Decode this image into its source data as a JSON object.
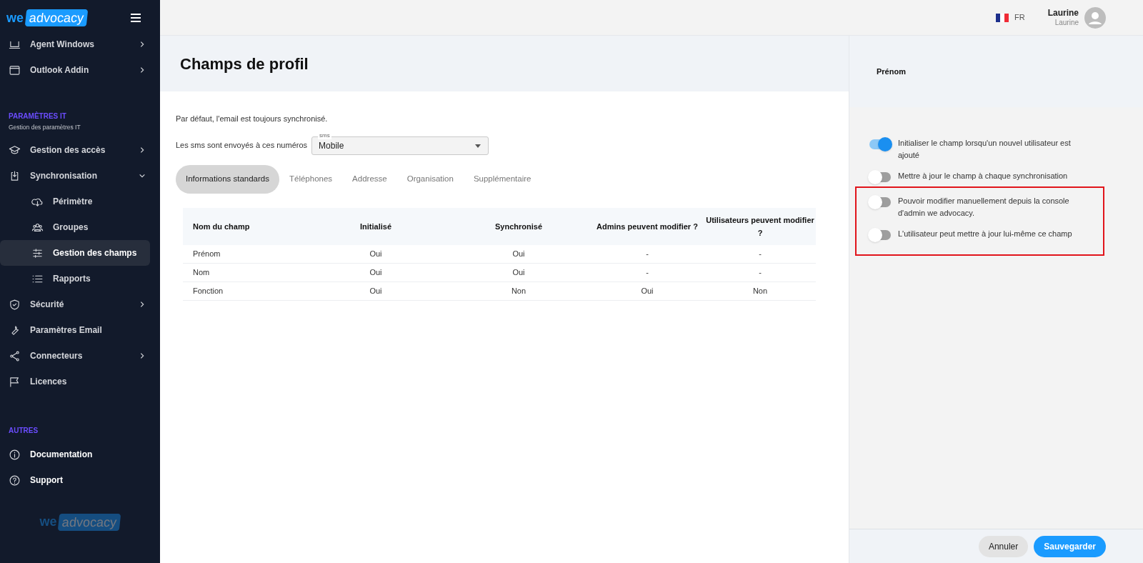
{
  "sidebar": {
    "logo": {
      "we": "we",
      "brand": "advocacy"
    },
    "menu_groups": [
      {
        "items": [
          {
            "label": "Agent Windows",
            "expandable": true,
            "expanded": false,
            "selected": false
          },
          {
            "label": "Outlook Addin",
            "expandable": true,
            "expanded": false,
            "selected": false
          }
        ]
      },
      {
        "title": "PARAMÈTRES IT",
        "subtitle": "Gestion des paramètres IT",
        "items": [
          {
            "label": "Gestion des accès",
            "expandable": true,
            "expanded": false,
            "selected": false
          },
          {
            "label": "Synchronisation",
            "expandable": true,
            "expanded": true,
            "selected": false,
            "children": [
              {
                "label": "Périmètre",
                "selected": false
              },
              {
                "label": "Groupes",
                "selected": false
              },
              {
                "label": "Gestion des champs",
                "selected": true
              },
              {
                "label": "Rapports",
                "selected": false
              }
            ]
          },
          {
            "label": "Sécurité",
            "expandable": true,
            "expanded": false,
            "selected": false
          },
          {
            "label": "Paramètres Email",
            "expandable": false,
            "selected": false
          },
          {
            "label": "Connecteurs",
            "expandable": true,
            "expanded": false,
            "selected": false
          },
          {
            "label": "Licences",
            "expandable": false,
            "selected": false
          }
        ]
      },
      {
        "title": "AUTRES",
        "items": [
          {
            "label": "Documentation",
            "selected": false
          },
          {
            "label": "Support",
            "selected": false
          }
        ]
      }
    ],
    "footer_logo": {
      "we": "we",
      "brand": "advocacy"
    }
  },
  "topbar": {
    "language": "FR",
    "user": {
      "name": "Laurine",
      "subtitle": "Laurine"
    }
  },
  "page": {
    "title": "Champs de profil",
    "intro": "Par défaut, l'email est toujours synchronisé.",
    "sms": {
      "label": "Les sms sont envoyés à ces numéros",
      "field_label": "sms",
      "value": "Mobile"
    },
    "tabs": [
      {
        "label": "Informations standards",
        "selected": true
      },
      {
        "label": "Téléphones",
        "selected": false
      },
      {
        "label": "Addresse",
        "selected": false
      },
      {
        "label": "Organisation",
        "selected": false
      },
      {
        "label": "Supplémentaire",
        "selected": false
      }
    ],
    "table": {
      "columns": [
        "Nom du champ",
        "Initialisé",
        "Synchronisé",
        "Admins peuvent modifier ?",
        "Utilisateurs peuvent modifier ?"
      ],
      "rows": [
        [
          "Prénom",
          "Oui",
          "Oui",
          "-",
          "-"
        ],
        [
          "Nom",
          "Oui",
          "Oui",
          "-",
          "-"
        ],
        [
          "Fonction",
          "Oui",
          "Non",
          "Oui",
          "Non"
        ]
      ]
    }
  },
  "detail_panel": {
    "title": "Prénom",
    "toggles": [
      {
        "label": "Initialiser le champ lorsqu'un nouvel utilisateur est ajouté",
        "on": true,
        "highlighted": false
      },
      {
        "label": "Mettre à jour le champ à chaque synchronisation",
        "on": false,
        "highlighted": false
      },
      {
        "label": "Pouvoir modifier manuellement depuis la console d'admin we advocacy.",
        "on": false,
        "highlighted": true
      },
      {
        "label": "L'utilisateur peut mettre à jour lui-même ce champ",
        "on": false,
        "highlighted": true
      }
    ],
    "buttons": [
      {
        "label": "Annuler",
        "kind": "secondary"
      },
      {
        "label": "Sauvegarder",
        "kind": "primary"
      }
    ]
  }
}
